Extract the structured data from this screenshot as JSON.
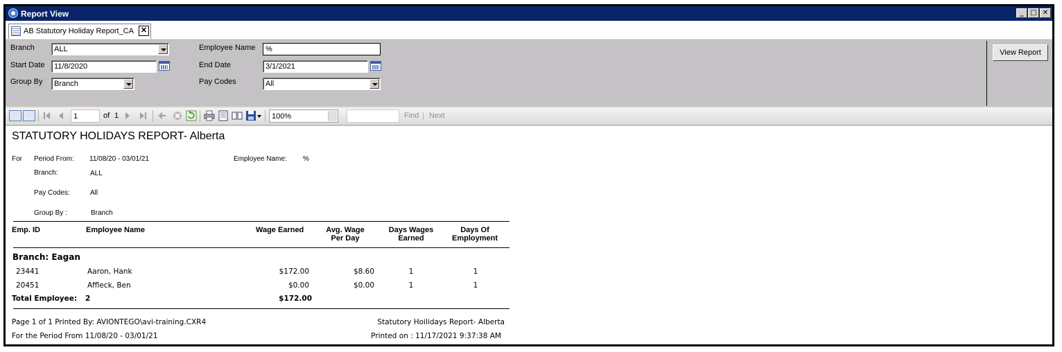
{
  "window": {
    "title": "Report View",
    "controls": {
      "minimize": "_",
      "maximize": "□",
      "close": "✕"
    }
  },
  "tab": {
    "label": "AB Statutory Holiday Report_CA",
    "close": "✕"
  },
  "params": {
    "branch_label": "Branch",
    "branch_value": "ALL",
    "start_date_label": "Start Date",
    "start_date_value": "11/8/2020",
    "group_by_label": "Group By",
    "group_by_value": "Branch",
    "employee_name_label": "Employee Name",
    "employee_name_value": "%",
    "end_date_label": "End Date",
    "end_date_value": "3/1/2021",
    "pay_codes_label": "Pay Codes",
    "pay_codes_value": "All",
    "view_report": "View Report"
  },
  "toolbar": {
    "page_value": "1",
    "of_label": "of",
    "total_pages": "1",
    "zoom_value": "100%",
    "find_label": "Find",
    "separator": "|",
    "next_label": "Next"
  },
  "report": {
    "title": "STATUTORY HOLIDAYS REPORT- Alberta",
    "for_label": "For",
    "period_from_label": "Period From:",
    "period_from_value": "11/08/20 - 03/01/21",
    "employee_name_label": "Employee Name:",
    "employee_name_value": "%",
    "branch_label": "Branch:",
    "branch_value": "ALL",
    "pay_codes_label": "Pay Codes:",
    "pay_codes_value": "All",
    "group_by_label": "Group By :",
    "group_by_value": "Branch",
    "columns": {
      "emp_id": "Emp. ID",
      "employee_name": "Employee Name",
      "wage_earned": "Wage Earned",
      "avg_wage_1": "Avg. Wage",
      "avg_wage_2": "Per Day",
      "days_wages_1": "Days Wages",
      "days_wages_2": "Earned",
      "days_of_1": "Days Of",
      "days_of_2": "Employment"
    },
    "group_header": "Branch: Eagan",
    "rows": [
      {
        "emp_id": "23441",
        "name": "Aaron, Hank",
        "wage": "$172.00",
        "avg": "$8.60",
        "days_wages": "1",
        "days_emp": "1"
      },
      {
        "emp_id": "20451",
        "name": "Affleck, Ben",
        "wage": "$0.00",
        "avg": "$0.00",
        "days_wages": "1",
        "days_emp": "1"
      }
    ],
    "total_label": "Total Employee:",
    "total_count": "2",
    "total_wage": "$172.00",
    "footer": {
      "page_info": "Page 1 of 1 Printed By: AVIONTEGO\\avi-training.CXR4",
      "period": "For the Period From 11/08/20 - 03/01/21",
      "report_name": "Statutory Hoilidays Report- Alberta",
      "printed_on": "Printed on : 11/17/2021 9:37:38 AM"
    }
  }
}
